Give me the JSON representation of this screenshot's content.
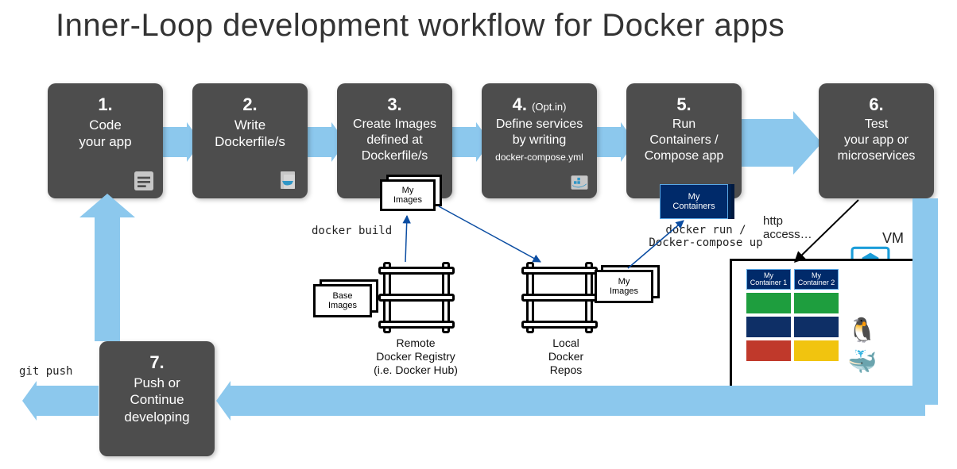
{
  "title": "Inner-Loop development workflow for Docker apps",
  "steps": {
    "s1": {
      "num": "1.",
      "desc": "Code\nyour app"
    },
    "s2": {
      "num": "2.",
      "desc": "Write\nDockerfile/s"
    },
    "s3": {
      "num": "3.",
      "desc": "Create Images\ndefined at\nDockerfile/s"
    },
    "s4": {
      "num": "4.",
      "sub": "(Opt.in)",
      "desc": "Define services\nby writing",
      "small": "docker-compose.yml"
    },
    "s5": {
      "num": "5.",
      "desc": "Run\nContainers /\nCompose app"
    },
    "s6": {
      "num": "6.",
      "desc": "Test\nyour app or\nmicroservices"
    },
    "s7": {
      "num": "7.",
      "desc": "Push or\nContinue\ndeveloping"
    }
  },
  "labels": {
    "docker_build": "docker build",
    "docker_run": "docker run /\nDocker-compose up",
    "http_access": "http\naccess…",
    "git_push": "git push",
    "vm": "VM",
    "my_images": "My\nImages",
    "base_images": "Base\nImages",
    "my_containers": "My\nContainers",
    "my_container1": "My\nContainer 1",
    "my_container2": "My\nContainer 2"
  },
  "captions": {
    "remote_registry": "Remote\nDocker Registry\n(i.e. Docker Hub)",
    "local_repos": "Local\nDocker\nRepos"
  },
  "colors": {
    "step_bg": "#4d4d4d",
    "flow": "#8cc8ed",
    "navy": "#002a6a",
    "green": "#1e9e3e",
    "darkblue": "#0e2f66",
    "red": "#c0392b",
    "yellow": "#f1c40f"
  }
}
